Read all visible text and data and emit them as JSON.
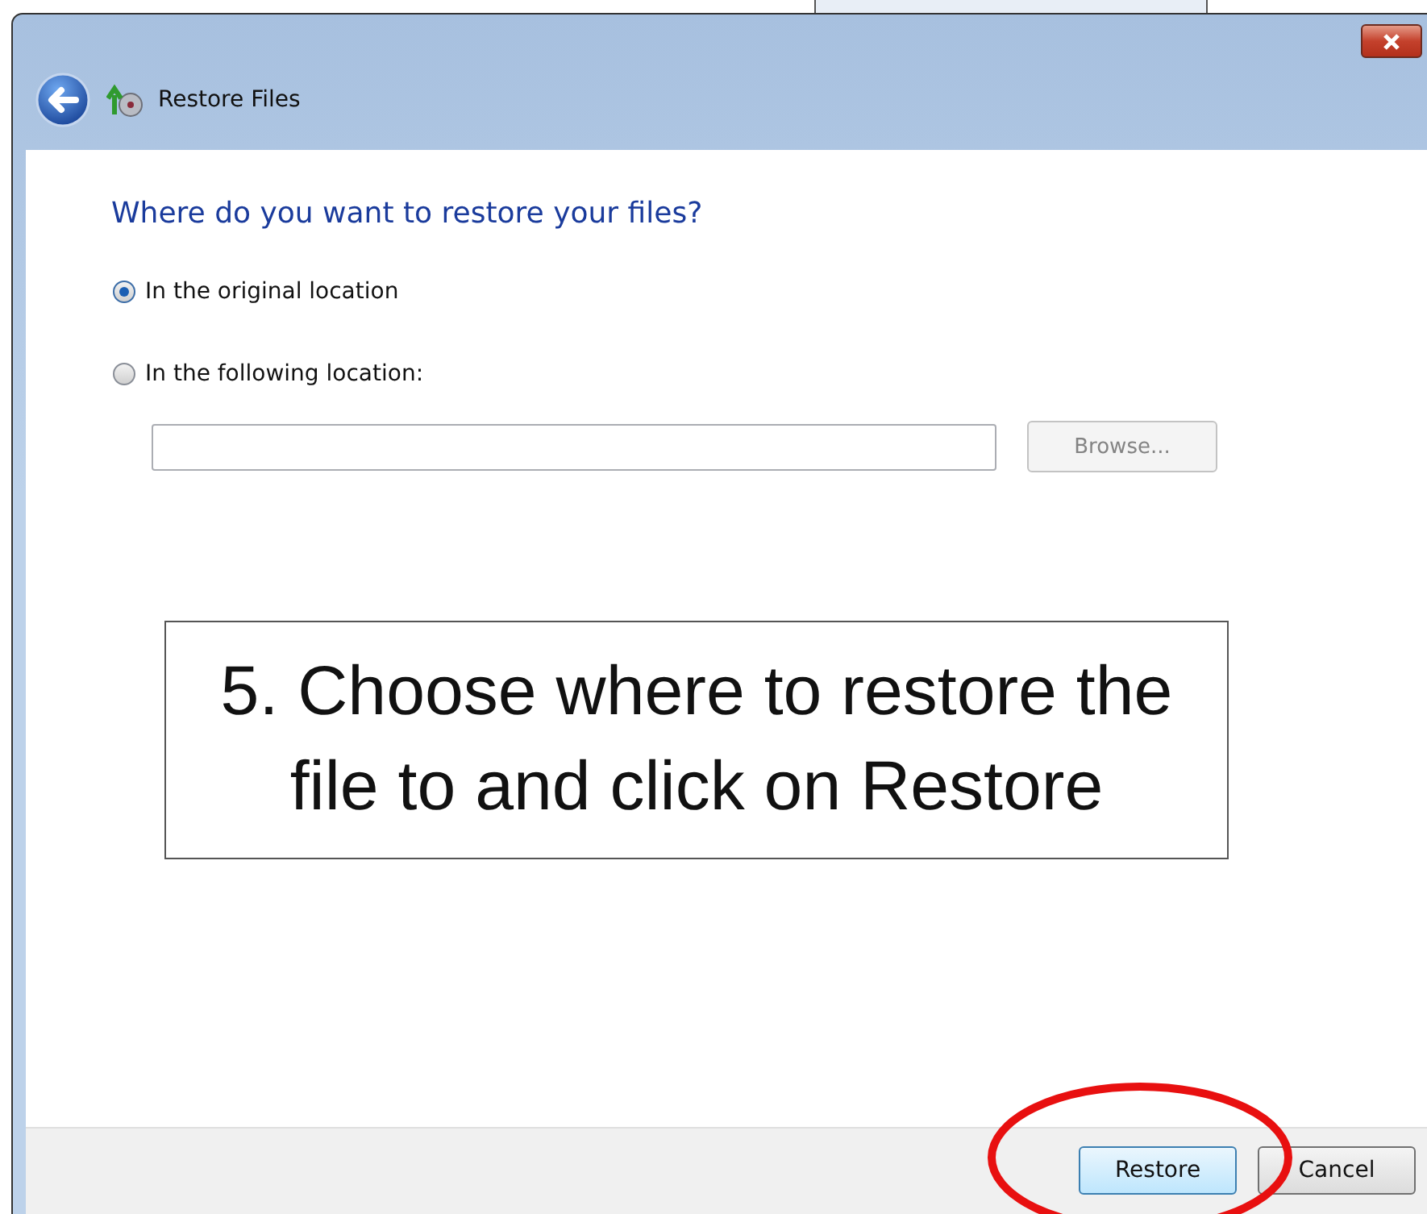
{
  "window": {
    "title": "Restore Files"
  },
  "heading": "Where do you want to restore your files?",
  "options": [
    {
      "label": "In the original location",
      "selected": true
    },
    {
      "label": "In the following location:",
      "selected": false
    }
  ],
  "browse_button": {
    "label": "Browse...",
    "disabled": true
  },
  "callout": "5. Choose where to restore the file to and click on Restore",
  "buttons": [
    {
      "label": "Restore",
      "default": true
    },
    {
      "label": "Cancel",
      "default": false
    }
  ]
}
